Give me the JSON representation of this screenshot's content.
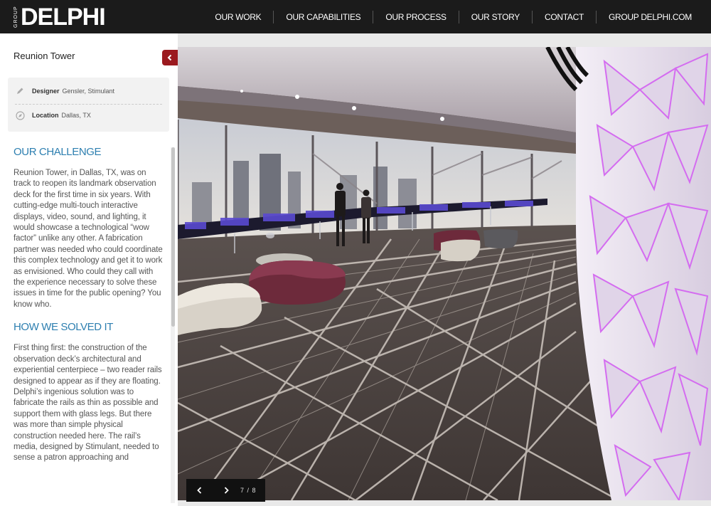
{
  "brand": {
    "small": "GROUP",
    "name": "DELPHI"
  },
  "nav": [
    {
      "label": "OUR WORK"
    },
    {
      "label": "OUR CAPABILITIES"
    },
    {
      "label": "OUR PROCESS"
    },
    {
      "label": "OUR STORY"
    },
    {
      "label": "CONTACT"
    },
    {
      "label": "GROUP DELPHI.COM"
    }
  ],
  "project": {
    "title": "Reunion Tower",
    "designer_label": "Designer",
    "designer_value": "Gensler, Stimulant",
    "location_label": "Location",
    "location_value": "Dallas, TX"
  },
  "sections": [
    {
      "heading": "OUR CHALLENGE",
      "body": "Reunion Tower, in Dallas, TX, was on track to reopen its landmark observation deck for the first time in six years. With cutting-edge multi-touch interactive displays, video, sound, and lighting, it would showcase a technological “wow factor” unlike any other. A fabrication partner was needed who could coordinate this complex technology and get it to work as envisioned. Who could they call with the experience necessary to solve these issues in time for the public opening? You know who."
    },
    {
      "heading": "HOW WE SOLVED IT",
      "body": "First thing first: the construction of the observation deck’s architectural and experiential centerpiece – two reader rails designed to appear as if they are floating. Delphi’s ingenious solution was to fabricate the rails as thin as possible and support them with glass legs. But there was more than simple physical construction needed here. The rail’s media, designed by Stimulant, needed to sense a patron approaching and"
    }
  ],
  "gallery": {
    "current": 7,
    "total": 8,
    "counter": "7 / 8"
  },
  "colors": {
    "accent_red": "#9b1a1f",
    "heading_blue": "#2d7fb0",
    "topbar": "#1b1b1b"
  }
}
